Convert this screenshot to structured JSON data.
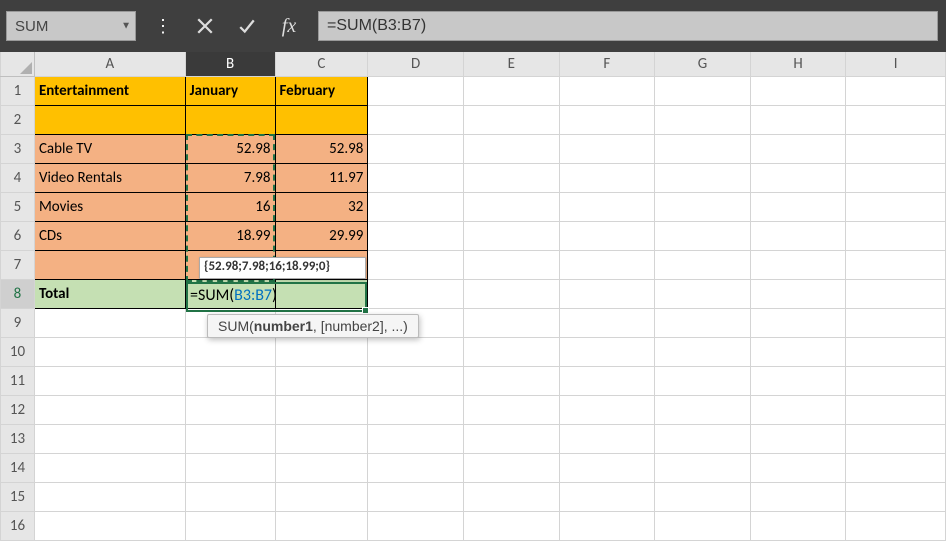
{
  "name_box": "SUM",
  "formula_bar": "=SUM(B3:B7)",
  "columns": [
    "A",
    "B",
    "C",
    "D",
    "E",
    "F",
    "G",
    "H",
    "I"
  ],
  "rows": [
    "1",
    "2",
    "3",
    "4",
    "5",
    "6",
    "7",
    "8",
    "9",
    "10",
    "11",
    "12",
    "13",
    "14",
    "15",
    "16"
  ],
  "cells": {
    "A1": "Entertainment",
    "B1": "January",
    "C1": "February",
    "A3": "Cable TV",
    "B3": "52.98",
    "C3": "52.98",
    "A4": "Video Rentals",
    "B4": "7.98",
    "C4": "11.97",
    "A5": "Movies",
    "B5": "16",
    "C5": "32",
    "A6": "CDs",
    "B6": "18.99",
    "C6": "29.99",
    "A8": "Total"
  },
  "editing_formula": {
    "prefix": "=SUM(",
    "ref": "B3:B7",
    "suffix": ")"
  },
  "array_preview": "{52.98;7.98;16;18.99;0}",
  "tooltip": {
    "fn": "SUM",
    "arg1": "number1",
    "rest": ", [number2], ...)"
  },
  "chart_data": {
    "type": "table",
    "title": "Entertainment",
    "categories": [
      "Cable TV",
      "Video Rentals",
      "Movies",
      "CDs"
    ],
    "series": [
      {
        "name": "January",
        "values": [
          52.98,
          7.98,
          16,
          18.99
        ]
      },
      {
        "name": "February",
        "values": [
          52.98,
          11.97,
          32,
          29.99
        ]
      }
    ]
  }
}
